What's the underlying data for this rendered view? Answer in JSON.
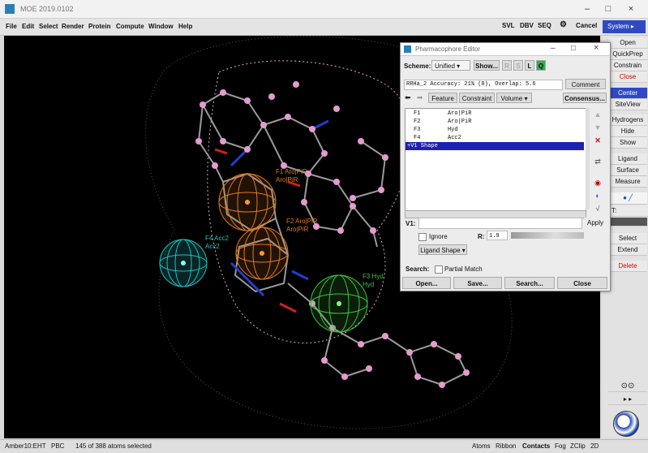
{
  "window": {
    "title": "MOE 2019.0102",
    "min_icon": "minimize-icon",
    "max_icon": "maximize-icon",
    "close_icon": "close-icon",
    "min": "–",
    "max": "□",
    "close": "×"
  },
  "menu": [
    "File",
    "Edit",
    "Select",
    "Render",
    "Protein",
    "Compute",
    "Window",
    "Help"
  ],
  "toolbar": {
    "svl": "SVL",
    "dbv": "DBV",
    "seq": "SEQ",
    "gear": "⚙",
    "cancel": "Cancel",
    "system": "System"
  },
  "right_panel": {
    "items": [
      "Open",
      "QuickPrep",
      "Constrain",
      "Close",
      "Center",
      "SiteView",
      "Hydrogens",
      "Hide",
      "Show",
      "Ligand",
      "Surface",
      "Measure",
      "T:",
      "Select",
      "Extend",
      "Delete"
    ]
  },
  "editor": {
    "title": "Pharmacophore Editor",
    "scheme_label": "Scheme:",
    "scheme_value": "Unified",
    "show_btn": "Show...",
    "small_btns": [
      "R",
      "S",
      "L",
      "Q"
    ],
    "summary": "RRHa_2 Accuracy: 21% (8), Overlap: 5.6",
    "comment_btn": "Comment",
    "feature_btn": "Feature",
    "constraint_btn": "Constraint",
    "volume_btn": "Volume",
    "consensus_btn": "Consensus...",
    "features": [
      {
        "id": "F1",
        "expr": "Aro|PiR"
      },
      {
        "id": "F2",
        "expr": "Aro|PiR"
      },
      {
        "id": "F3",
        "expr": "Hyd"
      },
      {
        "id": "F4",
        "expr": "Acc2"
      }
    ],
    "selected_row": "+V1 Shape",
    "v1_label": "V1:",
    "apply_btn": "Apply",
    "ignore_label": "Ignore",
    "r_label": "R:",
    "r_value": "1.9",
    "ligand_shape": "Ligand Shape ▾",
    "search_label": "Search:",
    "partial_match": "Partial Match",
    "bottom_btns": [
      "Open...",
      "Save...",
      "Search...",
      "Close"
    ]
  },
  "viewport_labels": {
    "f1": "F1 Aro|PiR",
    "f1b": "Aro|PiR",
    "f2": "F2 Aro|PiR",
    "f2b": "Aro|PiR",
    "f3": "F3 Hyd",
    "f3b": "Hyd",
    "f4": "F4 Acc2",
    "f4b": "Acc2"
  },
  "colors": {
    "aro": "#e07a1a",
    "acc": "#1fc0c0",
    "hyd": "#3fc23f",
    "accent": "#2f49c4"
  },
  "status": {
    "forcefield": "Amber10:EHT",
    "pbc": "PBC",
    "selected": "145 of 388 atoms selected",
    "tabs": [
      "Atoms",
      "Ribbon",
      "Contacts",
      "Fog",
      "ZClip",
      "2D"
    ]
  }
}
